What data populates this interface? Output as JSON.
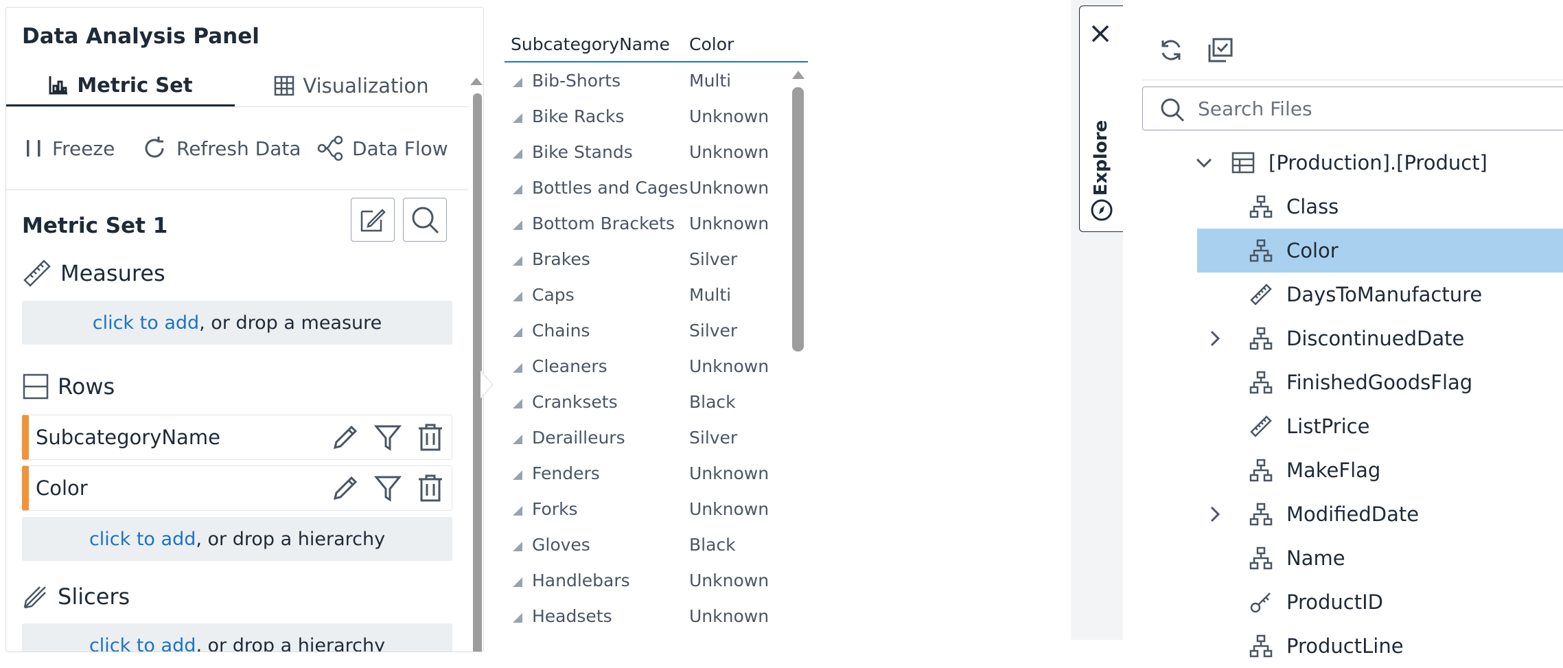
{
  "left_panel": {
    "title": "Data Analysis Panel",
    "tabs": [
      {
        "label": "Metric Set",
        "active": true
      },
      {
        "label": "Visualization",
        "active": false
      }
    ],
    "toolbar": {
      "freeze": "Freeze",
      "refresh": "Refresh Data",
      "data_flow": "Data Flow"
    },
    "metric_set_title": "Metric Set 1",
    "measures": {
      "title": "Measures",
      "link": "click to add",
      "rest": ", or drop a measure"
    },
    "rows": {
      "title": "Rows",
      "fields": [
        "SubcategoryName",
        "Color"
      ],
      "link": "click to add",
      "rest": ", or drop a hierarchy"
    },
    "slicers": {
      "title": "Slicers",
      "link": "click to add",
      "rest": ", or drop a hierarchy"
    }
  },
  "table": {
    "headers": [
      "SubcategoryName",
      "Color"
    ],
    "rows": [
      [
        "Bib-Shorts",
        "Multi"
      ],
      [
        "Bike Racks",
        "Unknown"
      ],
      [
        "Bike Stands",
        "Unknown"
      ],
      [
        "Bottles and Cages",
        "Unknown"
      ],
      [
        "Bottom Brackets",
        "Unknown"
      ],
      [
        "Brakes",
        "Silver"
      ],
      [
        "Caps",
        "Multi"
      ],
      [
        "Chains",
        "Silver"
      ],
      [
        "Cleaners",
        "Unknown"
      ],
      [
        "Cranksets",
        "Black"
      ],
      [
        "Derailleurs",
        "Silver"
      ],
      [
        "Fenders",
        "Unknown"
      ],
      [
        "Forks",
        "Unknown"
      ],
      [
        "Gloves",
        "Black"
      ],
      [
        "Handlebars",
        "Unknown"
      ],
      [
        "Headsets",
        "Unknown"
      ]
    ]
  },
  "explore": {
    "tab_label": "Explore",
    "search_placeholder": "Search Files",
    "tree_root": "[Production].[Product]",
    "tree_items": [
      {
        "label": "Class",
        "icon": "hierarchy-icon",
        "expandable": false,
        "selected": false
      },
      {
        "label": "Color",
        "icon": "hierarchy-icon",
        "expandable": false,
        "selected": true
      },
      {
        "label": "DaysToManufacture",
        "icon": "ruler-icon",
        "expandable": false,
        "selected": false
      },
      {
        "label": "DiscontinuedDate",
        "icon": "hierarchy-icon",
        "expandable": true,
        "selected": false
      },
      {
        "label": "FinishedGoodsFlag",
        "icon": "hierarchy-icon",
        "expandable": false,
        "selected": false
      },
      {
        "label": "ListPrice",
        "icon": "ruler-icon",
        "expandable": false,
        "selected": false
      },
      {
        "label": "MakeFlag",
        "icon": "hierarchy-icon",
        "expandable": false,
        "selected": false
      },
      {
        "label": "ModifiedDate",
        "icon": "hierarchy-icon",
        "expandable": true,
        "selected": false
      },
      {
        "label": "Name",
        "icon": "hierarchy-icon",
        "expandable": false,
        "selected": false
      },
      {
        "label": "ProductID",
        "icon": "key-icon",
        "expandable": false,
        "selected": false
      },
      {
        "label": "ProductLine",
        "icon": "hierarchy-icon",
        "expandable": false,
        "selected": false
      }
    ]
  },
  "colors": {
    "accent": "#1a73c7",
    "field_bar": "#f0933a",
    "selected_row": "#a9d1ef"
  }
}
